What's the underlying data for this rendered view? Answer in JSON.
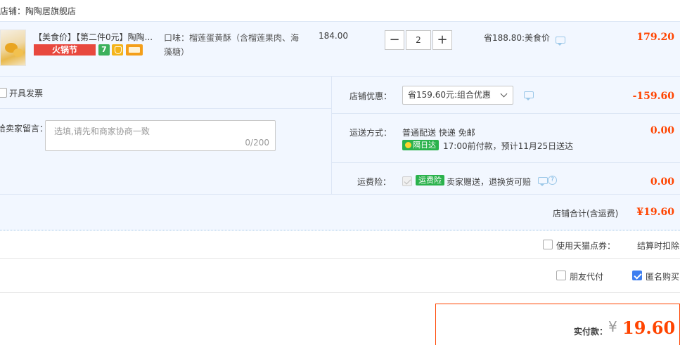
{
  "store": {
    "label": "店铺：陶陶居旗舰店"
  },
  "item": {
    "title": "【美食价】【第二件0元】陶陶...",
    "promo_badge": "火锅节",
    "icon7_text": "7",
    "flavor": "口味：榴莲蛋黄酥（含榴莲果肉、海藻糖）",
    "unit_price": "184.00",
    "quantity": "2",
    "minus": "−",
    "plus": "+",
    "saving": "省188.80:美食价",
    "subtotal": "179.20"
  },
  "options": {
    "invoice_label": "开具发票",
    "message_label": "给卖家留言：",
    "message_placeholder": "选填,请先和商家协商一致",
    "message_count": "0/200",
    "store_discount_label": "店铺优惠：",
    "store_discount_select": "省159.60元:组合优惠",
    "store_discount_amount": "-159.60",
    "shipping_label": "运送方式：",
    "shipping_method": "普通配送 快递 免邮",
    "sameday_badge": "隔日达",
    "shipping_eta": "17:00前付款，预计11月25日送达",
    "shipping_amount": "0.00",
    "insurance_label": "运费险：",
    "insurance_badge": "运费险",
    "insurance_text": "卖家赠送，退换货可赔",
    "insurance_amount": "0.00",
    "help_glyph": "?"
  },
  "store_total": {
    "label": "店铺合计(含运费)",
    "amount": "¥19.60"
  },
  "coupon": {
    "label": "使用天猫点券：",
    "note": "结算时扣除"
  },
  "friend_pay": {
    "label": "朋友代付"
  },
  "anonymous": {
    "label": "匿名购买"
  },
  "payment": {
    "label": "实付款：",
    "currency": "¥",
    "amount": "19.60"
  },
  "colors": {
    "accent_red": "#ff4400",
    "panel_bg": "#f2f7ff",
    "badge_green": "#2bb24c",
    "promo_red": "#e8483e"
  }
}
